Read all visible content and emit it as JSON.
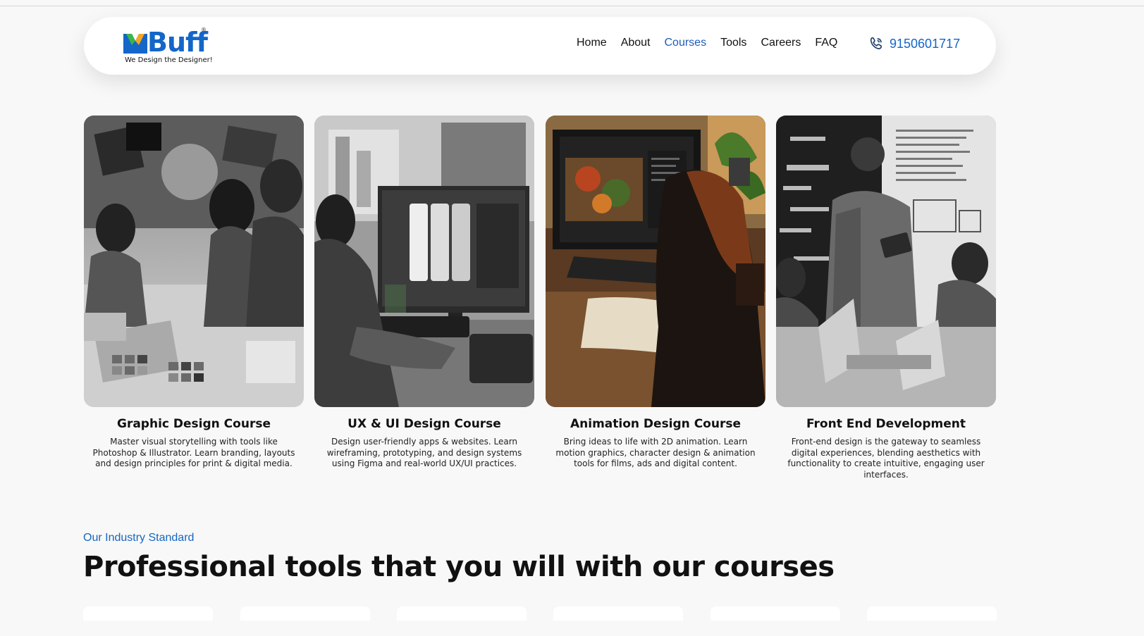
{
  "brand": {
    "name": "Buff",
    "tagline": "We Design the Designer!",
    "reg": "®",
    "colors": {
      "primary": "#1466c8",
      "accent_orange": "#f5a623",
      "accent_green": "#3db54a"
    }
  },
  "nav": {
    "items": [
      {
        "label": "Home",
        "active": false
      },
      {
        "label": "About",
        "active": false
      },
      {
        "label": "Courses",
        "active": true
      },
      {
        "label": "Tools",
        "active": false
      },
      {
        "label": "Careers",
        "active": false
      },
      {
        "label": "FAQ",
        "active": false
      }
    ],
    "phone": {
      "icon": "phone-icon",
      "number": "9150601717"
    }
  },
  "courses": [
    {
      "title": "Graphic Design Course",
      "description": "Master visual storytelling with tools like Photoshop & Illustrator. Learn branding, layouts and design principles for print & digital media."
    },
    {
      "title": "UX & UI Design Course",
      "description": "Design user-friendly apps & websites. Learn wireframing, prototyping, and design systems using Figma and real-world UX/UI practices."
    },
    {
      "title": "Animation Design Course",
      "description": "Bring ideas to life with 2D animation. Learn motion graphics, character design & animation tools for films, ads and digital content."
    },
    {
      "title": "Front End Development",
      "description": "Front-end design is the gateway to seamless digital experiences, blending aesthetics with functionality to create intuitive, engaging user interfaces."
    }
  ],
  "tools_section": {
    "eyebrow": "Our Industry Standard",
    "heading": "Professional tools that you will with our courses"
  }
}
